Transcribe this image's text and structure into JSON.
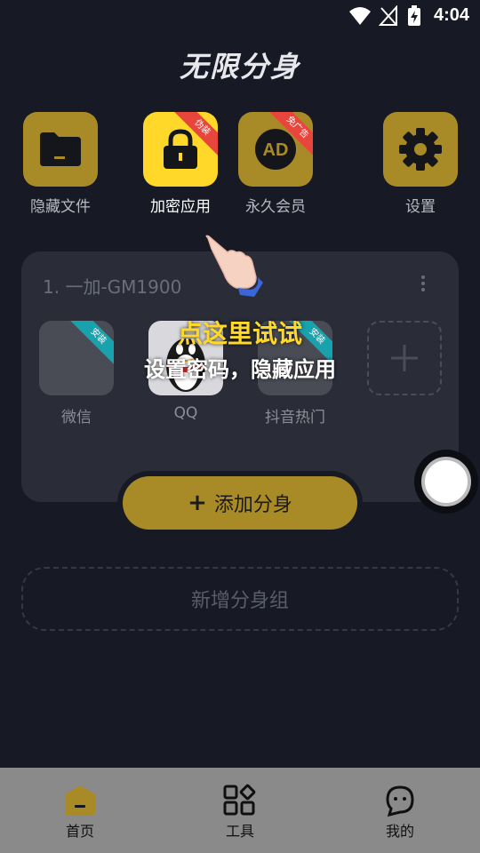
{
  "status_bar": {
    "time": "4:04"
  },
  "app_title": "无限分身",
  "features": [
    {
      "label": "隐藏文件",
      "icon": "folder-icon",
      "badge": ""
    },
    {
      "label": "加密应用",
      "icon": "lock-icon",
      "badge": "伪装"
    },
    {
      "label": "永久会员",
      "icon": "ad-icon",
      "badge": "免广告"
    },
    {
      "label": "设置",
      "icon": "gear-icon",
      "badge": ""
    }
  ],
  "clone_group": {
    "title": "1. 一加-GM1900",
    "apps": [
      {
        "name": "微信",
        "badge": "安装"
      },
      {
        "name": "QQ",
        "badge": ""
      },
      {
        "name": "抖音热门",
        "badge": "安装"
      }
    ]
  },
  "tip": {
    "title": "点这里试试",
    "subtitle": "设置密码，隐藏应用"
  },
  "add_clone_label": "添加分身",
  "add_clone_plus": "+",
  "new_group_label": "新增分身组",
  "nav": [
    {
      "label": "首页",
      "icon": "home-icon"
    },
    {
      "label": "工具",
      "icon": "tools-icon"
    },
    {
      "label": "我的",
      "icon": "profile-icon"
    }
  ],
  "colors": {
    "accent": "#a88a26",
    "highlight": "#ffd829",
    "badge_red": "#e8453c",
    "badge_teal": "#17a2ae"
  }
}
